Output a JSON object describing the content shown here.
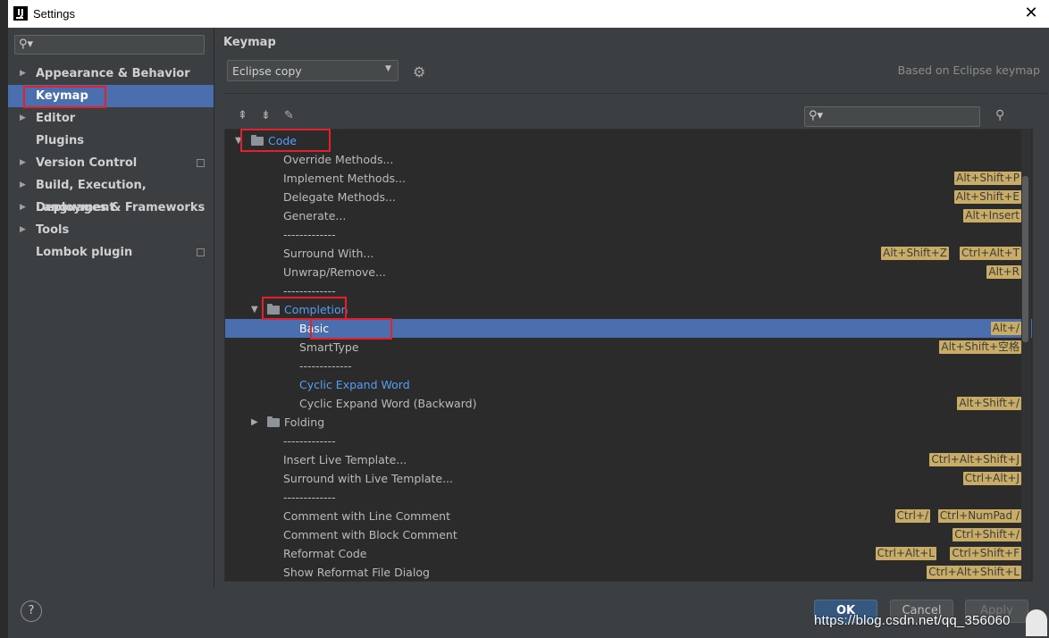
{
  "window": {
    "title": "Settings"
  },
  "sidebar": {
    "search_placeholder": "",
    "items": [
      {
        "label": "Appearance & Behavior",
        "expandable": true,
        "project_icon": false
      },
      {
        "label": "Keymap",
        "expandable": false,
        "project_icon": false,
        "selected": true
      },
      {
        "label": "Editor",
        "expandable": true,
        "project_icon": false
      },
      {
        "label": "Plugins",
        "expandable": false,
        "project_icon": false
      },
      {
        "label": "Version Control",
        "expandable": true,
        "project_icon": true
      },
      {
        "label": "Build, Execution, Deployment",
        "expandable": true,
        "project_icon": false
      },
      {
        "label": "Languages & Frameworks",
        "expandable": true,
        "project_icon": false
      },
      {
        "label": "Tools",
        "expandable": true,
        "project_icon": false
      },
      {
        "label": "Lombok plugin",
        "expandable": false,
        "project_icon": true
      }
    ]
  },
  "keymap": {
    "header": "Keymap",
    "scheme": "Eclipse copy",
    "based_on": "Based on Eclipse keymap",
    "tree": [
      {
        "label": "Code",
        "kind": "folder",
        "level": 0,
        "expanded": true,
        "link": true,
        "shortcuts": []
      },
      {
        "label": "Override Methods...",
        "kind": "action",
        "level": 1,
        "shortcuts": []
      },
      {
        "label": "Implement Methods...",
        "kind": "action",
        "level": 1,
        "shortcuts": [
          "Alt+Shift+P"
        ]
      },
      {
        "label": "Delegate Methods...",
        "kind": "action",
        "level": 1,
        "shortcuts": [
          "Alt+Shift+E"
        ]
      },
      {
        "label": "Generate...",
        "kind": "action",
        "level": 1,
        "shortcuts": [
          "Alt+Insert"
        ]
      },
      {
        "label": "-------------",
        "kind": "separator",
        "level": 1,
        "shortcuts": []
      },
      {
        "label": "Surround With...",
        "kind": "action",
        "level": 1,
        "shortcuts": [
          "Alt+Shift+Z",
          "Ctrl+Alt+T"
        ]
      },
      {
        "label": "Unwrap/Remove...",
        "kind": "action",
        "level": 1,
        "shortcuts": [
          "Alt+R"
        ]
      },
      {
        "label": "-------------",
        "kind": "separator",
        "level": 1,
        "shortcuts": []
      },
      {
        "label": "Completion",
        "kind": "folder",
        "level": 1,
        "expanded": true,
        "link": true,
        "shortcuts": []
      },
      {
        "label": "Basic",
        "kind": "action",
        "level": 2,
        "selected": true,
        "shortcuts": [
          "Alt+/"
        ]
      },
      {
        "label": "SmartType",
        "kind": "action",
        "level": 2,
        "shortcuts": [
          "Alt+Shift+空格"
        ]
      },
      {
        "label": "-------------",
        "kind": "separator",
        "level": 2,
        "shortcuts": []
      },
      {
        "label": "Cyclic Expand Word",
        "kind": "action",
        "level": 2,
        "link": true,
        "shortcuts": []
      },
      {
        "label": "Cyclic Expand Word (Backward)",
        "kind": "action",
        "level": 2,
        "shortcuts": [
          "Alt+Shift+/"
        ]
      },
      {
        "label": "Folding",
        "kind": "folder",
        "level": 1,
        "expanded": false,
        "shortcuts": []
      },
      {
        "label": "-------------",
        "kind": "separator",
        "level": 1,
        "shortcuts": []
      },
      {
        "label": "Insert Live Template...",
        "kind": "action",
        "level": 1,
        "shortcuts": [
          "Ctrl+Alt+Shift+J"
        ]
      },
      {
        "label": "Surround with Live Template...",
        "kind": "action",
        "level": 1,
        "shortcuts": [
          "Ctrl+Alt+J"
        ]
      },
      {
        "label": "-------------",
        "kind": "separator",
        "level": 1,
        "shortcuts": []
      },
      {
        "label": "Comment with Line Comment",
        "kind": "action",
        "level": 1,
        "shortcuts": [
          "Ctrl+/",
          "Ctrl+NumPad /"
        ]
      },
      {
        "label": "Comment with Block Comment",
        "kind": "action",
        "level": 1,
        "shortcuts": [
          "Ctrl+Shift+/"
        ]
      },
      {
        "label": "Reformat Code",
        "kind": "action",
        "level": 1,
        "shortcuts": [
          "Ctrl+Alt+L",
          "Ctrl+Shift+F"
        ]
      },
      {
        "label": "Show Reformat File Dialog",
        "kind": "action",
        "level": 1,
        "shortcuts": [
          "Ctrl+Alt+Shift+L"
        ]
      }
    ]
  },
  "buttons": {
    "help": "?",
    "ok": "OK",
    "cancel": "Cancel",
    "apply": "Apply"
  },
  "watermark": "https://blog.csdn.net/qq_356060",
  "colors": {
    "selection": "#4b6eaf",
    "shortcut_bg": "#c9ad67",
    "link": "#589df6",
    "annotation": "#e5202a"
  }
}
